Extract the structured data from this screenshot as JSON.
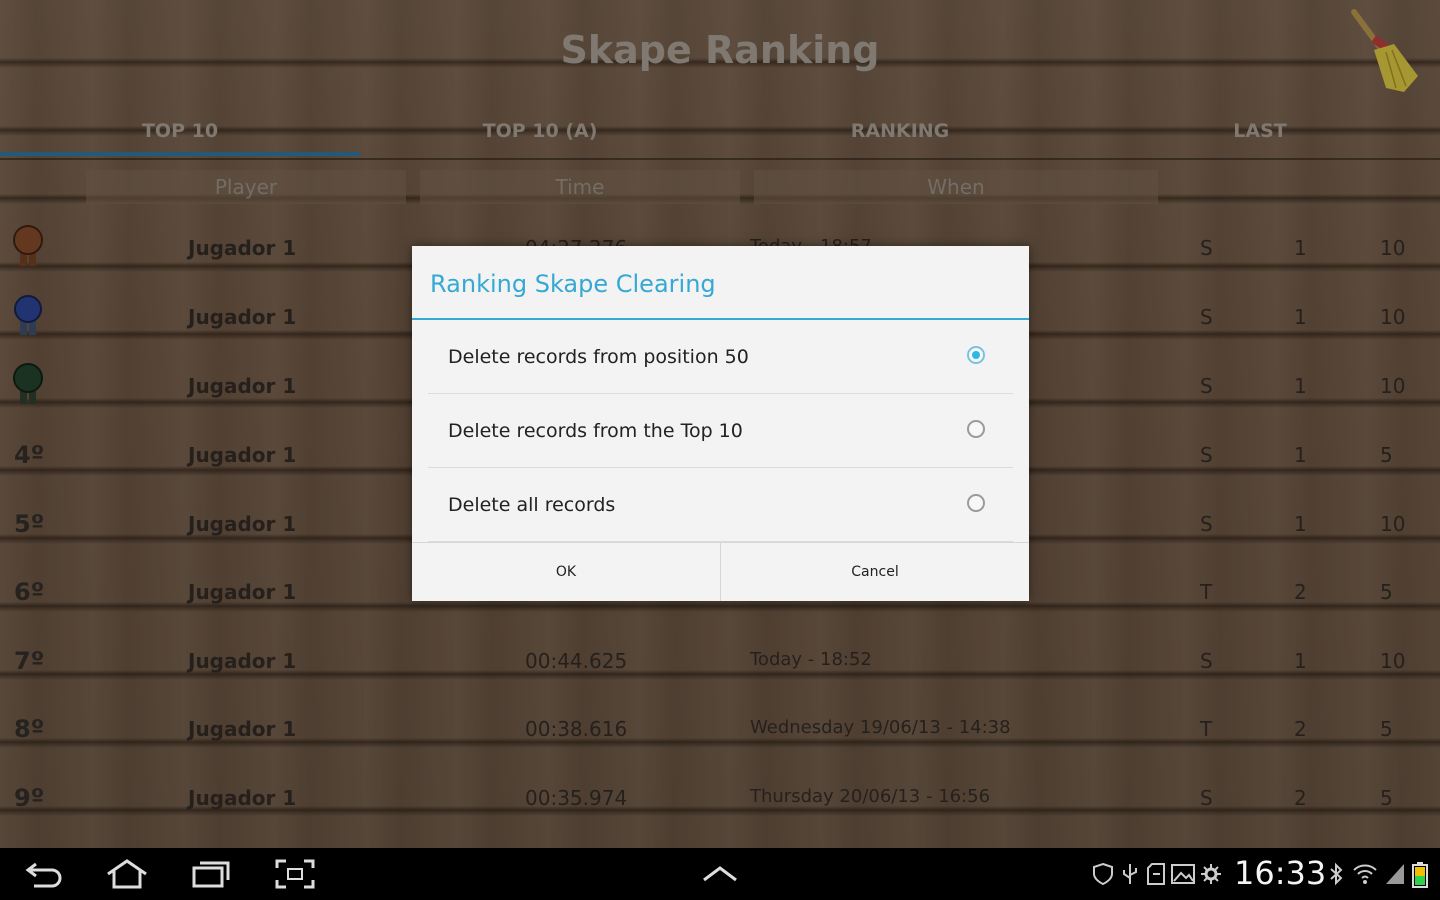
{
  "app": {
    "title": "Skape Ranking",
    "tabs": [
      {
        "label": "TOP 10",
        "active": true
      },
      {
        "label": "TOP 10 (A)",
        "active": false
      },
      {
        "label": "RANKING",
        "active": false
      },
      {
        "label": "LAST",
        "active": false
      }
    ],
    "columns": {
      "player": "Player",
      "time": "Time",
      "when": "When"
    },
    "rows": [
      {
        "rank": "",
        "medal": "bronze",
        "player": "Jugador 1",
        "time": "04:27.276",
        "when": "Today - 18:57",
        "c1": "S",
        "c2": "1",
        "c3": "10"
      },
      {
        "rank": "",
        "medal": "blue",
        "player": "Jugador 1",
        "time": "",
        "when": "",
        "c1": "S",
        "c2": "1",
        "c3": "10"
      },
      {
        "rank": "",
        "medal": "green",
        "player": "Jugador 1",
        "time": "",
        "when": "",
        "c1": "S",
        "c2": "1",
        "c3": "10"
      },
      {
        "rank": "4º",
        "medal": "",
        "player": "Jugador 1",
        "time": "",
        "when": "",
        "c1": "S",
        "c2": "1",
        "c3": "5"
      },
      {
        "rank": "5º",
        "medal": "",
        "player": "Jugador 1",
        "time": "",
        "when": "",
        "c1": "S",
        "c2": "1",
        "c3": "10"
      },
      {
        "rank": "6º",
        "medal": "",
        "player": "Jugador 1",
        "time": "",
        "when": "",
        "c1": "T",
        "c2": "2",
        "c3": "5"
      },
      {
        "rank": "7º",
        "medal": "",
        "player": "Jugador 1",
        "time": "00:44.625",
        "when": "Today - 18:52",
        "c1": "S",
        "c2": "1",
        "c3": "10"
      },
      {
        "rank": "8º",
        "medal": "",
        "player": "Jugador 1",
        "time": "00:38.616",
        "when": "Wednesday 19/06/13 - 14:38",
        "c1": "T",
        "c2": "2",
        "c3": "5"
      },
      {
        "rank": "9º",
        "medal": "",
        "player": "Jugador 1",
        "time": "00:35.974",
        "when": "Thursday 20/06/13 - 16:56",
        "c1": "S",
        "c2": "2",
        "c3": "5"
      }
    ]
  },
  "dialog": {
    "title": "Ranking Skape Clearing",
    "options": [
      {
        "label": "Delete records from position 50",
        "selected": true
      },
      {
        "label": "Delete records from the Top 10",
        "selected": false
      },
      {
        "label": "Delete all records",
        "selected": false
      }
    ],
    "ok_label": "OK",
    "cancel_label": "Cancel"
  },
  "statusbar": {
    "clock": "16:33"
  },
  "colors": {
    "accent": "#33b5e5",
    "tab_indicator": "#2a6f93",
    "wood": "#6a5442"
  },
  "icons": {
    "header": "broom-icon",
    "nav": [
      "back-icon",
      "home-icon",
      "recent-apps-icon",
      "screenshot-icon",
      "up-chevron-icon"
    ],
    "status": [
      "shield-icon",
      "usb-icon",
      "sd-card-icon",
      "image-icon",
      "settings-icon",
      "bluetooth-icon",
      "wifi-icon",
      "signal-icon",
      "battery-icon"
    ]
  }
}
